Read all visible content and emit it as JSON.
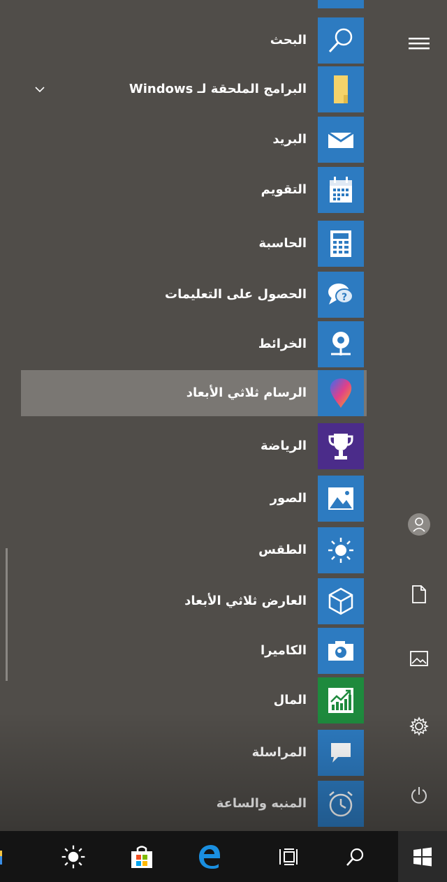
{
  "start_menu": {
    "apps": [
      {
        "label": "البحث",
        "icon": "search-icon",
        "tile_color": "#2d7bc1"
      },
      {
        "label": "البرامج الملحقة لـ Windows",
        "icon": "folder-icon",
        "tile_color": "#2d7bc1",
        "expandable": true
      },
      {
        "label": "البريد",
        "icon": "mail-icon",
        "tile_color": "#2d7bc1"
      },
      {
        "label": "التقويم",
        "icon": "calendar-icon",
        "tile_color": "#2d7bc1"
      },
      {
        "label": "الحاسبة",
        "icon": "calculator-icon",
        "tile_color": "#2d7bc1"
      },
      {
        "label": "الحصول على التعليمات",
        "icon": "help-chat-icon",
        "tile_color": "#2d7bc1"
      },
      {
        "label": "الخرائط",
        "icon": "maps-pin-icon",
        "tile_color": "#2d7bc1"
      },
      {
        "label": "الرسام ثلاثي الأبعاد",
        "icon": "paint3d-icon",
        "tile_color": "#2d7bc1",
        "highlighted": true
      },
      {
        "label": "الرياضة",
        "icon": "trophy-icon",
        "tile_color": "#4b2c8a"
      },
      {
        "label": "الصور",
        "icon": "photos-icon",
        "tile_color": "#2d7bc1"
      },
      {
        "label": "الطقس",
        "icon": "weather-sun-icon",
        "tile_color": "#2d7bc1"
      },
      {
        "label": "العارض ثلاثي الأبعاد",
        "icon": "3d-cube-icon",
        "tile_color": "#2d7bc1"
      },
      {
        "label": "الكاميرا",
        "icon": "camera-icon",
        "tile_color": "#2d7bc1"
      },
      {
        "label": "المال",
        "icon": "finance-chart-icon",
        "tile_color": "#1e8a3d"
      },
      {
        "label": "المراسلة",
        "icon": "messaging-icon",
        "tile_color": "#2d7bc1"
      },
      {
        "label": "المنبه والساعة",
        "icon": "alarm-clock-icon",
        "tile_color": "#2d7bc1"
      }
    ],
    "side_icons": [
      "hamburger-menu-icon",
      "user-avatar-icon",
      "documents-icon",
      "pictures-icon",
      "settings-gear-icon",
      "power-icon"
    ]
  },
  "taskbar": {
    "icons": [
      "start-windows-icon",
      "search-icon",
      "task-view-icon",
      "edge-browser-icon",
      "store-bag-icon",
      "weather-sun-icon",
      "file-explorer-icon"
    ]
  },
  "colors": {
    "menu_bg": "#504d49",
    "tile_blue": "#2d7bc1",
    "highlight": "#7a7773",
    "taskbar": "#141414"
  }
}
